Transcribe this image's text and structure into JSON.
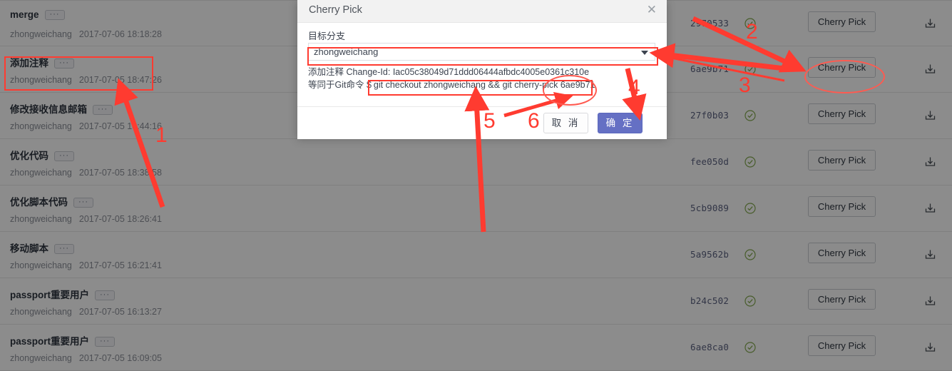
{
  "commit_list": {
    "rows": [
      {
        "title": "merge",
        "dots": "···",
        "author": "zhongweichang",
        "time": "2017-07-06 18:18:28",
        "hash": "2970533",
        "status": "check",
        "cherry_pick": "Cherry Pick",
        "download": "download-icon"
      },
      {
        "title": "添加注释",
        "dots": "···",
        "author": "zhongweichang",
        "time": "2017-07-05 18:47:26",
        "hash": "6ae9b71",
        "status": "check",
        "cherry_pick": "Cherry Pick",
        "download": "download-icon"
      },
      {
        "title": "修改接收信息邮箱",
        "dots": "···",
        "author": "zhongweichang",
        "time": "2017-07-05 18:44:16",
        "hash": "27f0b03",
        "status": "check",
        "cherry_pick": "Cherry Pick",
        "download": "download-icon"
      },
      {
        "title": "优化代码",
        "dots": "···",
        "author": "zhongweichang",
        "time": "2017-07-05 18:38:58",
        "hash": "fee050d",
        "status": "check",
        "cherry_pick": "Cherry Pick",
        "download": "download-icon"
      },
      {
        "title": "优化脚本代码",
        "dots": "···",
        "author": "zhongweichang",
        "time": "2017-07-05 18:26:41",
        "hash": "5cb9089",
        "status": "check",
        "cherry_pick": "Cherry Pick",
        "download": "download-icon"
      },
      {
        "title": "移动脚本",
        "dots": "···",
        "author": "zhongweichang",
        "time": "2017-07-05 16:21:41",
        "hash": "5a9562b",
        "status": "check",
        "cherry_pick": "Cherry Pick",
        "download": "download-icon"
      },
      {
        "title": "passport重要用户",
        "dots": "···",
        "author": "zhongweichang",
        "time": "2017-07-05 16:13:27",
        "hash": "b24c502",
        "status": "check",
        "cherry_pick": "Cherry Pick",
        "download": "download-icon"
      },
      {
        "title": "passport重要用户",
        "dots": "···",
        "author": "zhongweichang",
        "time": "2017-07-05 16:09:05",
        "hash": "6ae8ca0",
        "status": "check",
        "cherry_pick": "Cherry Pick",
        "download": "download-icon"
      }
    ]
  },
  "modal": {
    "title": "Cherry Pick",
    "close_icon": "close-icon",
    "branch_label": "目标分支",
    "branch_value": "zhongweichang",
    "branch_caret_icon": "chevron-down-icon",
    "changeid_label": "添加注释 Change-Id:",
    "changeid_value": "Iac05c38049d71ddd06444afbdc4005e0361c310e",
    "gitcmd_label": "等同于Git命令 $",
    "gitcmd_value": "git checkout zhongweichang && git cherry-pick 6ae9b71",
    "cancel_label": "取 消",
    "confirm_label": "确 定"
  },
  "annotations": {
    "accent_color": "#ff3b30",
    "numbers": [
      "1",
      "2",
      "3",
      "4",
      "5",
      "6"
    ]
  }
}
